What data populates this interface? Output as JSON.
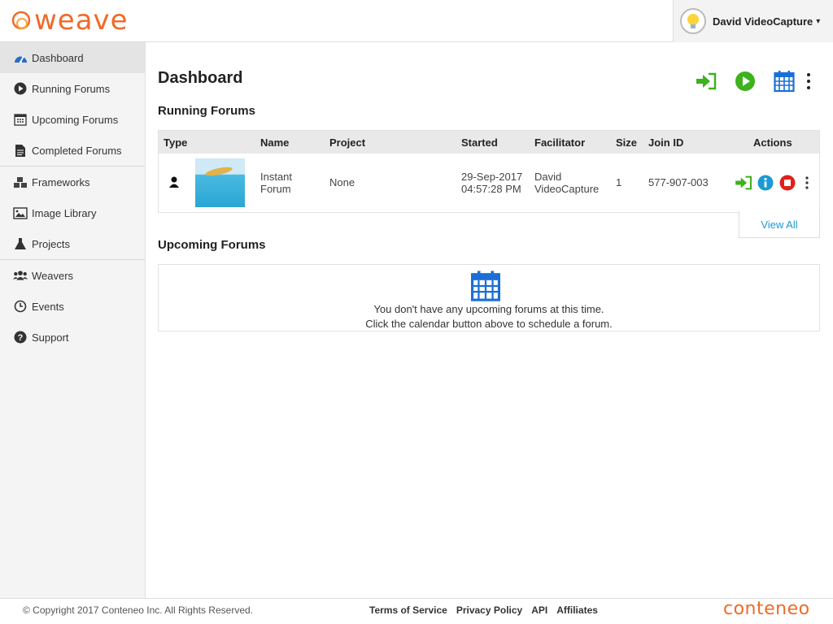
{
  "header": {
    "logo_text": "weave",
    "user_name": "David VideoCapture",
    "user_caret": "▾"
  },
  "sidebar": {
    "items": [
      {
        "label": "Dashboard",
        "icon": "dashboard-icon",
        "active": true
      },
      {
        "label": "Running Forums",
        "icon": "play-circle-icon"
      },
      {
        "label": "Upcoming Forums",
        "icon": "calendar-icon"
      },
      {
        "label": "Completed Forums",
        "icon": "document-icon"
      },
      {
        "label": "Frameworks",
        "icon": "cubes-icon"
      },
      {
        "label": "Image Library",
        "icon": "image-icon"
      },
      {
        "label": "Projects",
        "icon": "flask-icon"
      },
      {
        "label": "Weavers",
        "icon": "users-icon"
      },
      {
        "label": "Events",
        "icon": "clock-icon"
      },
      {
        "label": "Support",
        "icon": "help-icon"
      }
    ]
  },
  "main": {
    "title": "Dashboard",
    "running": {
      "title": "Running Forums",
      "columns": [
        "Type",
        "Name",
        "Project",
        "Started",
        "Facilitator",
        "Size",
        "Join ID",
        "Actions"
      ],
      "rows": [
        {
          "type_icon": "user-icon",
          "name_line1": "Instant",
          "name_line2": "Forum",
          "project": "None",
          "started_date": "29-Sep-2017",
          "started_time": "04:57:28 PM",
          "facilitator_line1": "David",
          "facilitator_line2": "VideoCapture",
          "size": "1",
          "join_id": "577-907-003"
        }
      ],
      "view_all": "View All"
    },
    "upcoming": {
      "title": "Upcoming Forums",
      "empty_line1": "You don't have any upcoming forums at this time.",
      "empty_line2": "Click the calendar button above to schedule a forum."
    }
  },
  "footer": {
    "copyright": "© Copyright 2017 Conteneo Inc. All Rights Reserved.",
    "links": [
      "Terms of Service",
      "Privacy Policy",
      "API",
      "Affiliates"
    ],
    "brand": "conteneo"
  },
  "colors": {
    "brand_orange": "#f06a28",
    "green": "#3cb21d",
    "blue": "#1a6fd6",
    "info_blue": "#1a9ad6",
    "red": "#e0201b"
  }
}
